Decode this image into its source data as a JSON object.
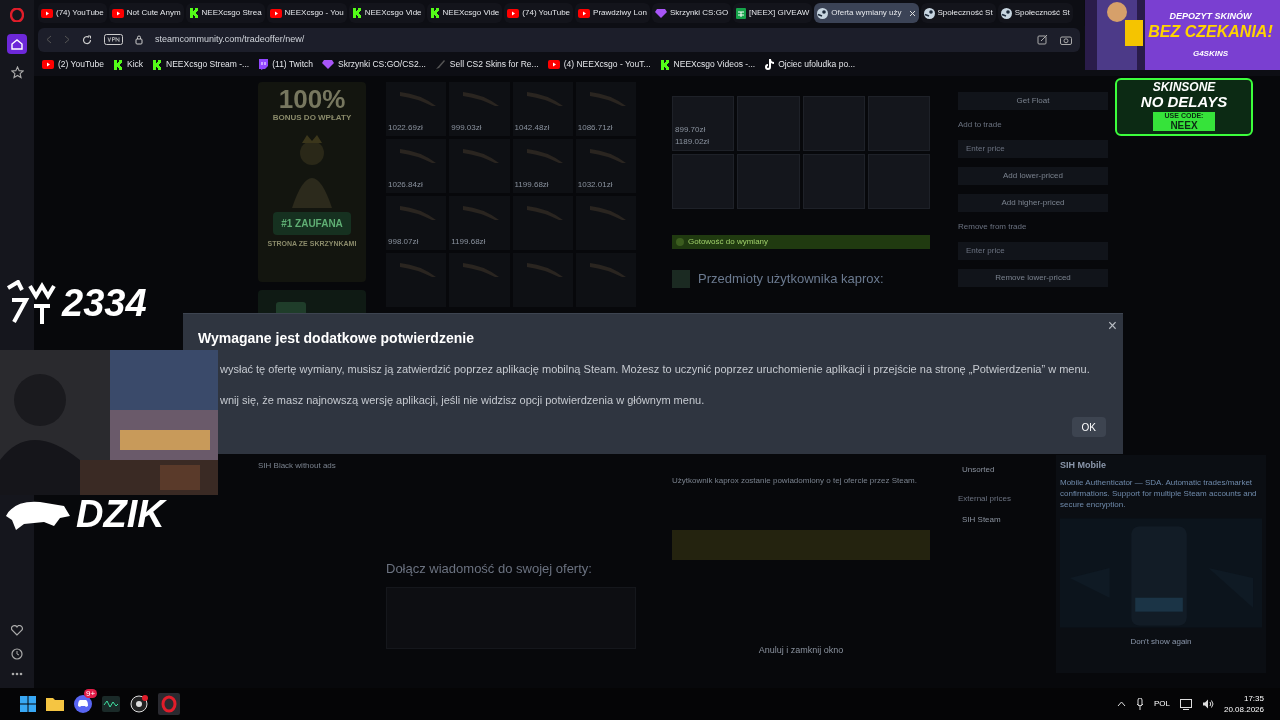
{
  "browser": {
    "tabs": [
      {
        "label": "(74) YouTube",
        "kind": "youtube",
        "selected": false
      },
      {
        "label": "Not Cute Anym",
        "kind": "youtube",
        "selected": false
      },
      {
        "label": "NEEXcsgo Strea",
        "kind": "kick",
        "selected": false
      },
      {
        "label": "NEEXcsgo - You",
        "kind": "youtube",
        "selected": false
      },
      {
        "label": "NEEXcsgo Vide",
        "kind": "kick",
        "selected": false
      },
      {
        "label": "NEEXcsgo Vide",
        "kind": "kick",
        "selected": false
      },
      {
        "label": "(74) YouTube",
        "kind": "youtube",
        "selected": false
      },
      {
        "label": "Prawdziwy Lon",
        "kind": "youtube",
        "selected": false
      },
      {
        "label": "Skrzynki CS:GO",
        "kind": "gem",
        "selected": false
      },
      {
        "label": "[NEEX] GIVEAW",
        "kind": "sheet",
        "selected": false
      },
      {
        "label": "Oferta wymiany uży",
        "kind": "steam",
        "selected": true
      },
      {
        "label": "Społeczność St",
        "kind": "steam",
        "selected": false
      },
      {
        "label": "Społeczność St",
        "kind": "steam",
        "selected": false
      }
    ],
    "address": "steamcommunity.com/tradeoffer/new/",
    "bookmarks": [
      {
        "label": "(2) YouTube",
        "kind": "youtube"
      },
      {
        "label": "Kick",
        "kind": "kick"
      },
      {
        "label": "NEEXcsgo Stream -...",
        "kind": "kick"
      },
      {
        "label": "(11) Twitch",
        "kind": "twitch"
      },
      {
        "label": "Skrzynki CS:GO/CS2...",
        "kind": "gem"
      },
      {
        "label": "Sell CS2 Skins for Re...",
        "kind": "knife"
      },
      {
        "label": "(4) NEEXcsgo - YouT...",
        "kind": "youtube"
      },
      {
        "label": "NEEXcsgo Videos -...",
        "kind": "kick"
      },
      {
        "label": "Ojciec ufoludka po...",
        "kind": "tiktok"
      }
    ]
  },
  "page": {
    "promo": {
      "headline": "100%",
      "subline": "BONUS DO WPŁATY",
      "badge": "#1 ZAUFANA",
      "tagline": "STRONA ZE SKRZYNKAMI"
    },
    "inventory": [
      {
        "kind": "priced",
        "price": "1022.69zł"
      },
      {
        "kind": "priced",
        "price": "999.03zł"
      },
      {
        "kind": "priced",
        "price": "1042.48zł"
      },
      {
        "kind": "priced",
        "price": "1086.71zł"
      },
      {
        "kind": "priced",
        "price": "1026.84zł"
      },
      {
        "kind": "blank"
      },
      {
        "kind": "priced",
        "price": "1199.68zł"
      },
      {
        "kind": "priced",
        "price": "1032.01zł"
      },
      {
        "kind": "priced",
        "price": "998.07zł"
      },
      {
        "kind": "priced",
        "price": "1199.68zł"
      },
      {
        "kind": "blank"
      },
      {
        "kind": "blank"
      },
      {
        "kind": "blank"
      },
      {
        "kind": "blank"
      },
      {
        "kind": "blank"
      },
      {
        "kind": "blank"
      }
    ],
    "sih_black": "SIH Black without ads",
    "trade": {
      "offer_prices": [
        "899.70zł",
        "1189.02zł"
      ],
      "ready": {
        "label": "Gotowość do wymiany",
        "checked": true
      },
      "partner_heading": "Przedmioty użytkownika kaprox:",
      "notice": "Użytkownik kaprox zostanie powiadomiony o tej ofercie przez Steam.",
      "cancel": "Anuluj i zamknij okno"
    },
    "message": {
      "heading": "Dołącz wiadomość do swojej oferty:"
    },
    "tools": {
      "get_float": "Get Float",
      "add_label": "Add to trade",
      "add_placeholder": "Enter price",
      "add_buttons": [
        "Add lower-priced",
        "Add higher-priced"
      ],
      "remove_label": "Remove from trade",
      "remove_placeholder": "Enter price",
      "remove_buttons": [
        "Remove lower-priced"
      ]
    },
    "sort": {
      "current": "Unsorted",
      "external_label": "External prices",
      "external": "SIH Steam"
    },
    "sih_mobile": {
      "title": "SIH Mobile",
      "description": "Mobile Authenticator — SDA. Automatic trades/market confirmations. Support for multiple Steam accounts and secure encryption.",
      "dismiss": "Don't show again"
    }
  },
  "dialog": {
    "title": "Wymagane jest dodatkowe potwierdzenie",
    "paragraphs": [
      "wysłać tę ofertę wymiany, musisz ją zatwierdzić poprzez aplikację mobilną Steam. Możesz to uczynić poprzez uruchomienie aplikacji i przejście na stronę „Potwierdzenia” w menu.",
      "wnij się, że masz najnowszą wersję aplikacji, jeśli nie widzisz opcji potwierdzenia w głównym menu."
    ],
    "close": "×",
    "ok": "OK"
  },
  "overlays": {
    "ad_top": {
      "line1": "DEPOZYT SKINÓW",
      "line2": "BEZ CZEKANIA!",
      "brand": "G4SKINS"
    },
    "ad_side": {
      "brand": "SKINSONE",
      "line": "NO DELAYS",
      "code_label": "USE CODE:",
      "code": "NEEX"
    },
    "counter": "2334",
    "logo": "DZIK"
  },
  "taskbar": {
    "discord_badge": "9+",
    "language": "POL",
    "time": "17:35",
    "date": "20.08.2026"
  }
}
